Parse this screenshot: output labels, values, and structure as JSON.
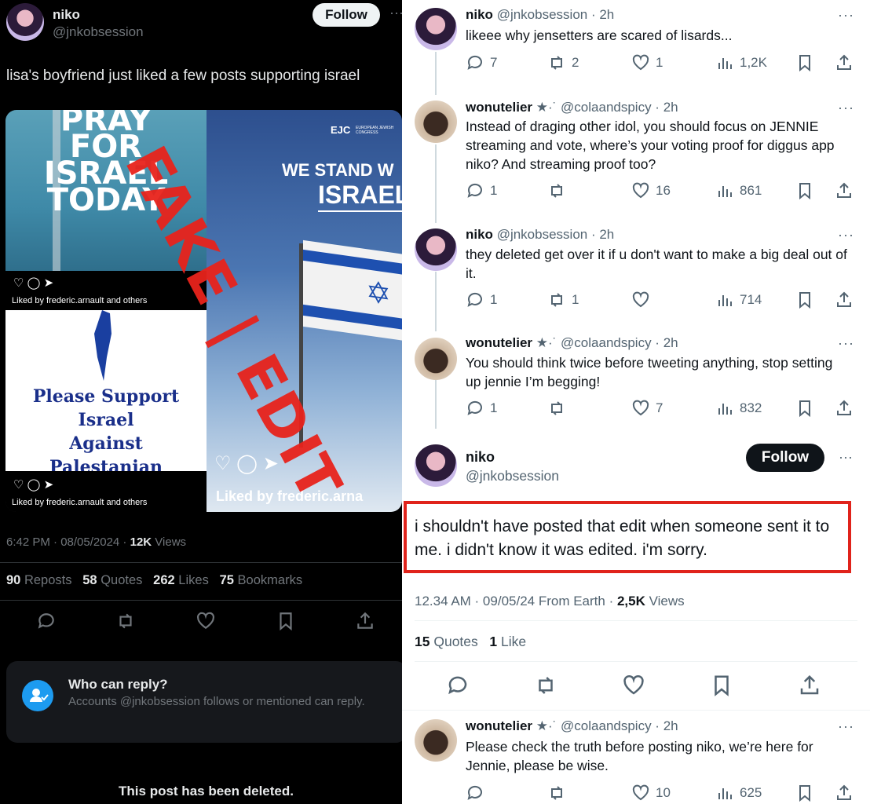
{
  "left": {
    "author": {
      "name": "niko",
      "handle": "@jnkobsession"
    },
    "follow_label": "Follow",
    "text": "lisa's boyfriend just liked a few posts supporting israel",
    "img1": {
      "lines": [
        "PRAY",
        "FOR",
        "ISRAEL",
        "TODAY"
      ],
      "liked_by": "Liked by frederic.arnault and others"
    },
    "img2": {
      "logo": "EJC",
      "logo_sub": "EUROPEAN JEWISH CONGRESS",
      "line1": "WE STAND W",
      "line2": "ISRAEL",
      "liked": "Liked by frederic.arna"
    },
    "img3": {
      "text": [
        "Please Support Israel",
        "Against",
        "Palestanian Terrorist"
      ],
      "liked_by": "Liked by frederic.arnault and others"
    },
    "watermark": "FAKE | EDIT",
    "meta": {
      "time": "6:42 PM · 08/05/2024 · ",
      "views_num": "12K",
      "views_label": " Views"
    },
    "stats": [
      {
        "num": "90",
        "label": "Reposts"
      },
      {
        "num": "58",
        "label": "Quotes"
      },
      {
        "num": "262",
        "label": "Likes"
      },
      {
        "num": "75",
        "label": "Bookmarks"
      }
    ],
    "reply_box": {
      "title": "Who can reply?",
      "body": "Accounts @jnkobsession follows or mentioned can reply."
    },
    "deleted": "This post has been deleted."
  },
  "right": {
    "tweets": [
      {
        "name": "niko",
        "handle": "@jnkobsession · 2h",
        "text": "likeee why jensetters are scared of lisards...",
        "replies": "7",
        "reposts": "2",
        "likes": "1",
        "views": "1,2K"
      },
      {
        "name": "wonutelier",
        "badge": "★·˙",
        "handle": "@colaandspicy · 2h",
        "text": "Instead of draging other idol, you should focus on JENNIE streaming and vote, where’s your voting proof for diggus app niko? And streaming proof too?",
        "replies": "1",
        "reposts": "",
        "likes": "16",
        "views": "861"
      },
      {
        "name": "niko",
        "handle": "@jnkobsession · 2h",
        "text": "they deleted get over it if u don't want to make a big deal out of it.",
        "replies": "1",
        "reposts": "1",
        "likes": "",
        "views": "714"
      },
      {
        "name": "wonutelier",
        "badge": "★·˙",
        "handle": "@colaandspicy · 2h",
        "text": "You should think twice before tweeting anything, stop setting up jennie I’m begging!",
        "replies": "1",
        "reposts": "",
        "likes": "7",
        "views": "832"
      }
    ],
    "main": {
      "name": "niko",
      "handle": "@jnkobsession",
      "follow_label": "Follow",
      "text": "i shouldn't have posted that edit when someone sent it to me. i didn't know it was edited. i'm sorry.",
      "meta_time": "12.34 AM · 09/05/24 From Earth · ",
      "views_num": "2,5K",
      "views_label": " Views",
      "quotes_num": "15",
      "quotes_label": "Quotes",
      "likes_num": "1",
      "likes_label": "Like"
    },
    "last": {
      "name": "wonutelier",
      "badge": "★·˙",
      "handle": "@colaandspicy · 2h",
      "text": "Please check the truth before posting niko, we’re here for Jennie, please be wise.",
      "replies": "",
      "reposts": "",
      "likes": "10",
      "views": "625"
    }
  }
}
